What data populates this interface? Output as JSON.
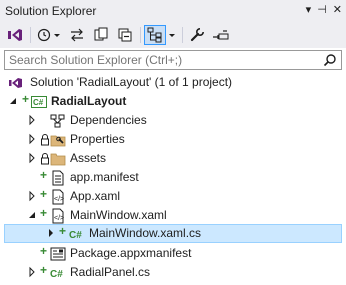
{
  "window": {
    "title": "Solution Explorer",
    "controls": [
      "▾",
      "⊣",
      "✕"
    ]
  },
  "search": {
    "placeholder": "Search Solution Explorer (Ctrl+;)"
  },
  "tree": {
    "solution": {
      "label": "Solution 'RadialLayout' (1 of 1 project)"
    },
    "project": {
      "label": "RadialLayout"
    },
    "items": [
      {
        "label": "Dependencies"
      },
      {
        "label": "Properties"
      },
      {
        "label": "Assets"
      },
      {
        "label": "app.manifest"
      },
      {
        "label": "App.xaml"
      },
      {
        "label": "MainWindow.xaml"
      },
      {
        "label": "MainWindow.xaml.cs"
      },
      {
        "label": "Package.appxmanifest"
      },
      {
        "label": "RadialPanel.cs"
      }
    ]
  },
  "colors": {
    "toolbar_bg": "#eeeef2",
    "selection": "#cce8ff",
    "accent": "#68217a",
    "add_green": "#388a34"
  }
}
